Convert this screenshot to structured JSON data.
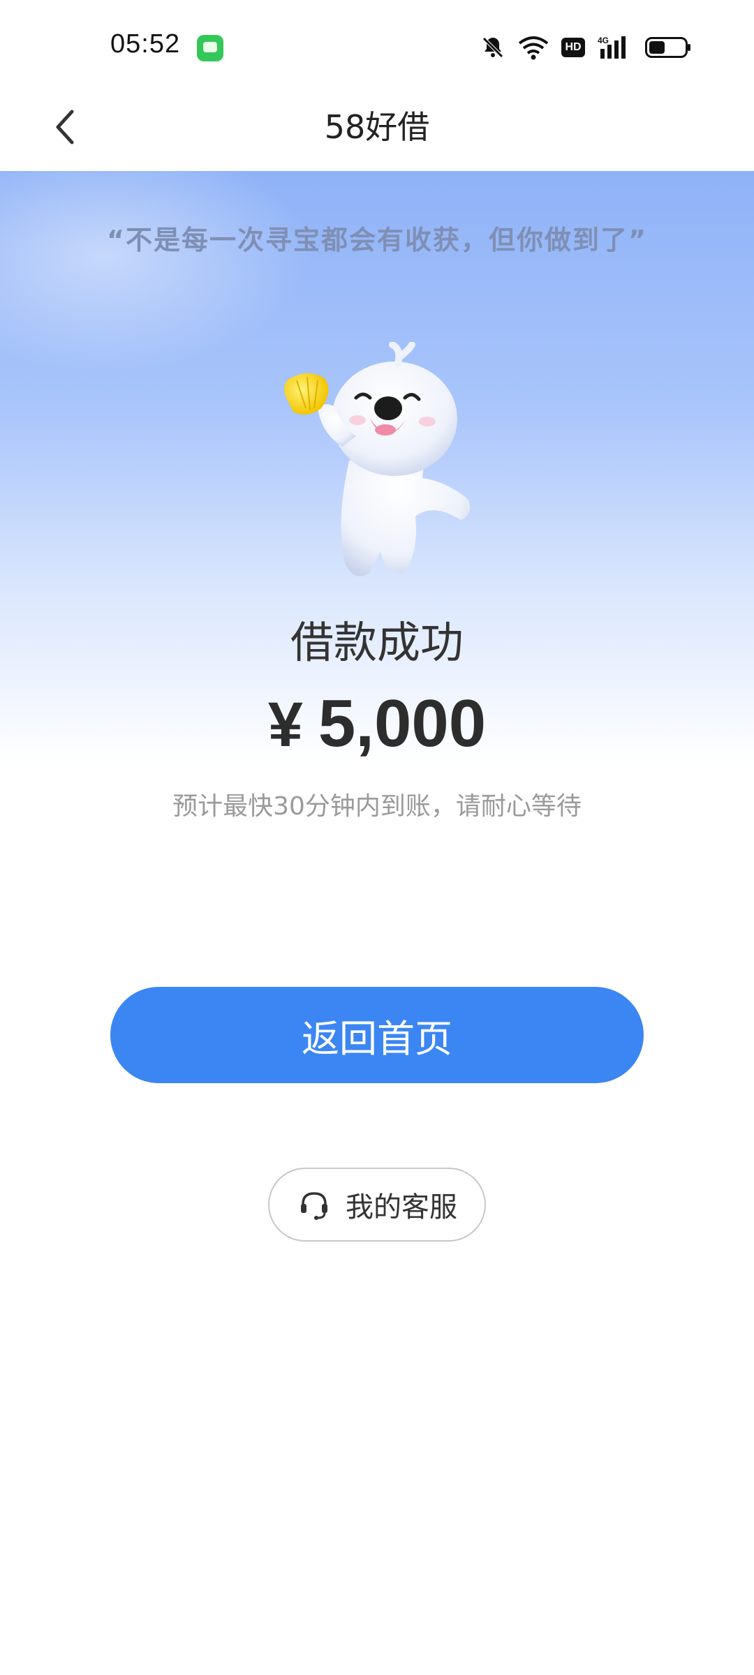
{
  "status_bar": {
    "time": "05:52",
    "icons": [
      "message-app-icon",
      "bell-off-icon",
      "wifi-icon",
      "hd-icon",
      "4g-signal-icon",
      "battery-icon"
    ],
    "hd_label": "HD",
    "network_label": "4G"
  },
  "nav": {
    "title": "58好借",
    "back_icon": "chevron-left-icon"
  },
  "hero": {
    "quote": "“不是每一次寻宝都会有收获，但你做到了”"
  },
  "result": {
    "title": "借款成功",
    "currency": "¥",
    "amount": "5,000",
    "hint": "预计最快30分钟内到账，请耐心等待"
  },
  "actions": {
    "home_label": "返回首页",
    "service_label": "我的客服",
    "service_icon": "headset-icon"
  },
  "colors": {
    "primary": "#3b86f3",
    "hero_top": "#8fb2f7",
    "text_dark": "#333333",
    "text_muted": "#9a9a9a"
  }
}
